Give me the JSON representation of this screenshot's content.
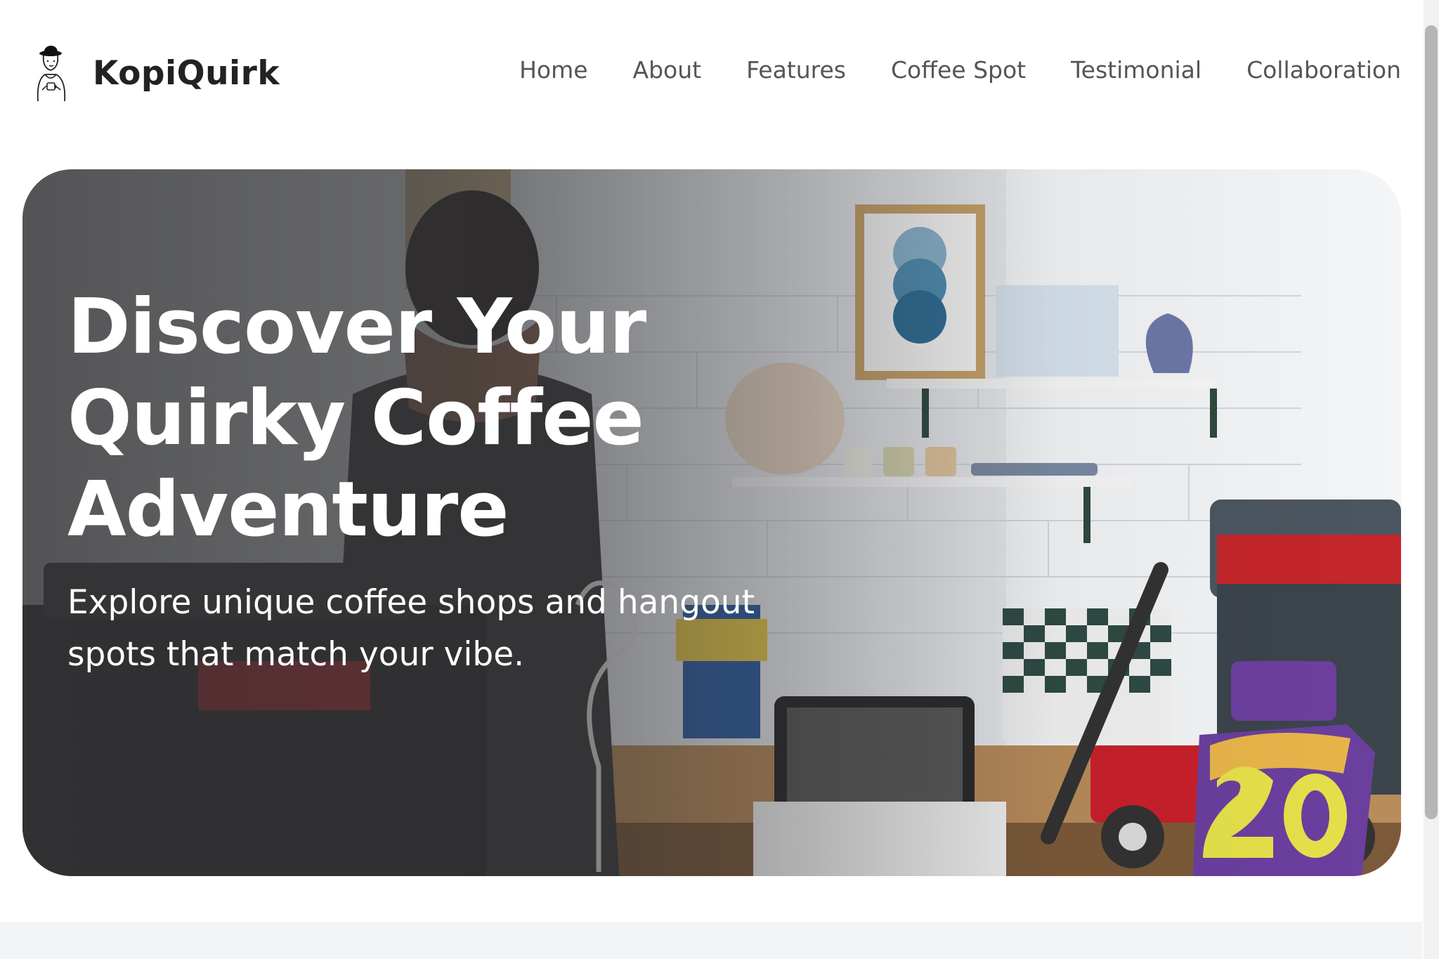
{
  "brand": {
    "name": "KopiQuirk",
    "logo_icon": "barista-illustration-icon"
  },
  "nav": {
    "items": [
      {
        "label": "Home"
      },
      {
        "label": "About"
      },
      {
        "label": "Features"
      },
      {
        "label": "Coffee Spot"
      },
      {
        "label": "Testimonial"
      },
      {
        "label": "Collaboration"
      }
    ]
  },
  "hero": {
    "title": "Discover Your Quirky Coffee Adventure",
    "subtitle": "Explore unique coffee shops and hangout spots that match your vibe."
  },
  "colors": {
    "text_dark": "#222222",
    "nav_text": "#555555",
    "hero_text": "#ffffff",
    "band": "#f3f4f6"
  }
}
